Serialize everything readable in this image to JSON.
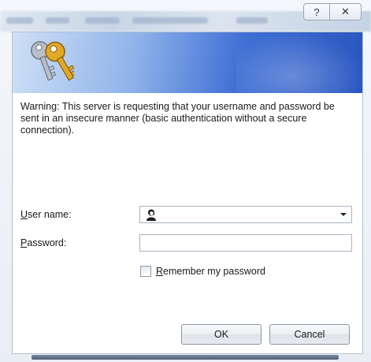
{
  "window": {
    "help_glyph": "?",
    "close_glyph": "✕"
  },
  "dialog": {
    "warning_text": "Warning: This server is requesting that your username and password be sent in an insecure manner (basic authentication without a secure connection).",
    "username": {
      "label_mnemonic": "U",
      "label_rest": "ser name:",
      "value": ""
    },
    "password": {
      "label_mnemonic": "P",
      "label_rest": "assword:",
      "value": ""
    },
    "remember": {
      "label_mnemonic": "R",
      "label_rest": "emember my password",
      "checked": false
    },
    "buttons": {
      "ok_label": "OK",
      "cancel_label": "Cancel"
    }
  },
  "colors": {
    "banner_start": "#cfe0f6",
    "banner_end": "#2a56c0",
    "key_gold": "#e0a928",
    "key_silver": "#b8bfc8"
  },
  "icons": {
    "banner_icon": "keys-icon",
    "username_icon": "user-icon"
  }
}
